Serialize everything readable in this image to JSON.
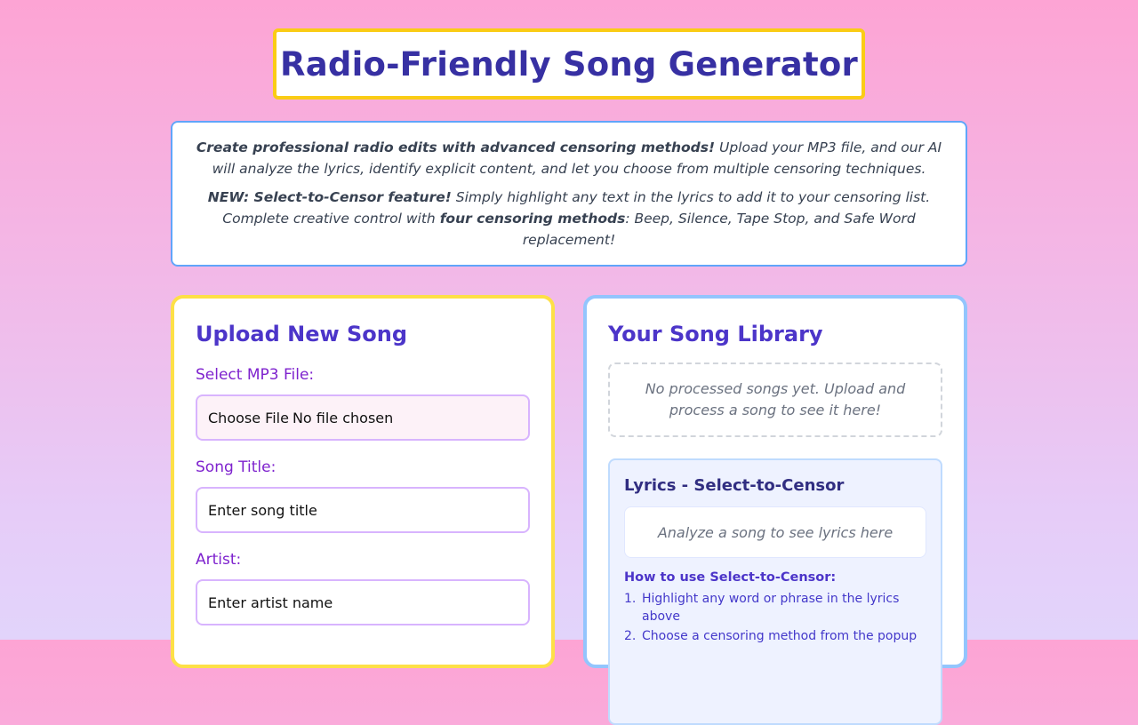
{
  "header": {
    "title": "Radio-Friendly Song Generator"
  },
  "intro": {
    "p1_bold": "Create professional radio edits with advanced censoring methods!",
    "p1_rest": " Upload your MP3 file, and our AI will analyze the lyrics, identify explicit content, and let you choose from multiple censoring techniques.",
    "p2_bold": "NEW: Select-to-Censor feature!",
    "p2_mid": " Simply highlight any text in the lyrics to add it to your censoring list. Complete creative control with ",
    "p2_bold2": "four censoring methods",
    "p2_end": ": Beep, Silence, Tape Stop, and Safe Word replacement!"
  },
  "upload": {
    "heading": "Upload New Song",
    "file_label": "Select MP3 File:",
    "file_button": "Choose File",
    "file_status": "No file chosen",
    "title_label": "Song Title:",
    "title_placeholder": "Enter song title",
    "artist_label": "Artist:",
    "artist_placeholder": "Enter artist name"
  },
  "library": {
    "heading": "Your Song Library",
    "empty_text": "No processed songs yet. Upload and process a song to see it here!",
    "lyrics": {
      "heading": "Lyrics - Select-to-Censor",
      "placeholder": "Analyze a song to see lyrics here",
      "howto_title": "How to use Select-to-Censor:",
      "steps": [
        {
          "num": "1.",
          "text": "Highlight any word or phrase in the lyrics above"
        },
        {
          "num": "2.",
          "text": "Choose a censoring method from the popup"
        }
      ]
    }
  },
  "colors": {
    "accent": "#3730a3",
    "title_border": "#facc15",
    "intro_border": "#60a5fa",
    "label": "#7e22ce"
  }
}
